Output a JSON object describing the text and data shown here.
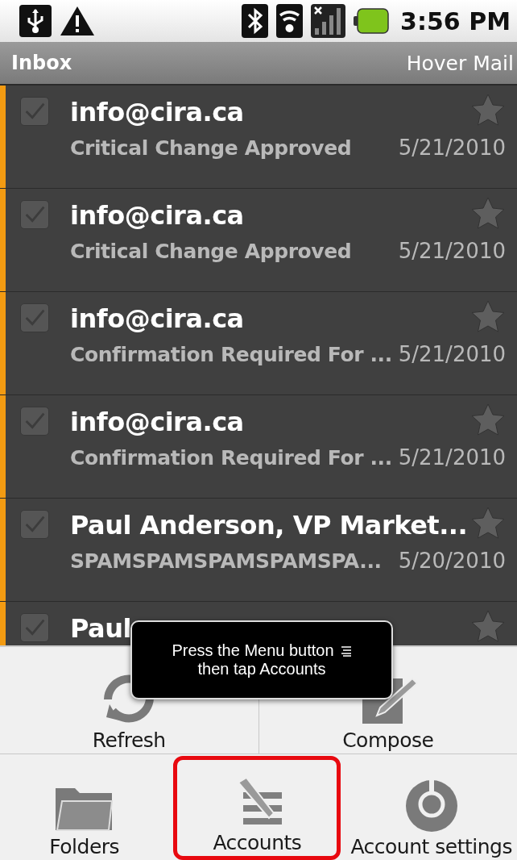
{
  "status_bar": {
    "time": "3:56 PM"
  },
  "title_bar": {
    "title": "Inbox",
    "account": "Hover Mail"
  },
  "messages": [
    {
      "sender": "info@cira.ca",
      "subject": "Critical Change Approved",
      "date": "5/21/2010",
      "unread": true,
      "checked": false,
      "starred": false
    },
    {
      "sender": "info@cira.ca",
      "subject": "Critical Change Approved",
      "date": "5/21/2010",
      "unread": true,
      "checked": false,
      "starred": false
    },
    {
      "sender": "info@cira.ca",
      "subject": "Confirmation Required For ...",
      "date": "5/21/2010",
      "unread": true,
      "checked": false,
      "starred": false
    },
    {
      "sender": "info@cira.ca",
      "subject": "Confirmation Required For ...",
      "date": "5/21/2010",
      "unread": true,
      "checked": false,
      "starred": false
    },
    {
      "sender": "Paul Anderson, VP Market...",
      "subject": "SPAMSPAMSPAMSPAMSPA...",
      "date": "5/20/2010",
      "unread": true,
      "checked": false,
      "starred": false
    },
    {
      "sender": "Paul",
      "unread": true,
      "checked": false,
      "starred": false
    }
  ],
  "tooltip": {
    "line_1": "Press the Menu button",
    "line_2": "then tap Accounts"
  },
  "menu": {
    "top_row": [
      {
        "kind": "refresh",
        "label": "Refresh",
        "highlighted": false
      },
      {
        "kind": "compose",
        "label": "Compose",
        "highlighted": false
      }
    ],
    "bottom_row": [
      {
        "kind": "folders",
        "label": "Folders",
        "highlighted": false
      },
      {
        "kind": "accounts",
        "label": "Accounts",
        "highlighted": true
      },
      {
        "kind": "settings",
        "label": "Account settings",
        "highlighted": false
      }
    ]
  }
}
